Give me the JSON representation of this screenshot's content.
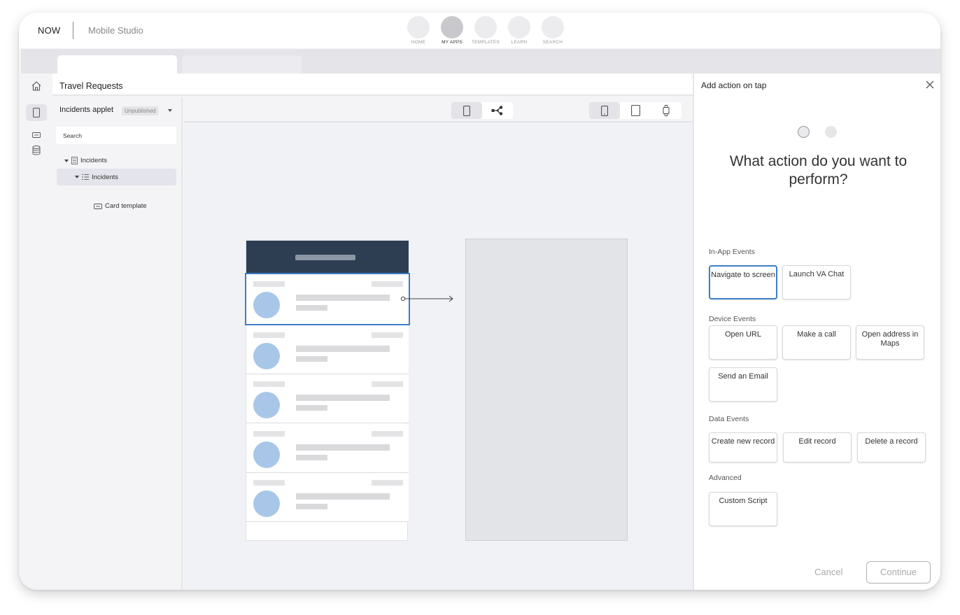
{
  "app": {
    "brand": "NOW",
    "product": "Mobile Studio"
  },
  "nav": [
    {
      "label": "HOME",
      "active": false
    },
    {
      "label": "MY APPS",
      "active": true
    },
    {
      "label": "TEMPLATES",
      "active": false
    },
    {
      "label": "LEARN",
      "active": false
    },
    {
      "label": "SEARCH",
      "active": false
    }
  ],
  "header": {
    "title": "Travel Requests"
  },
  "tree": {
    "applet_name": "Incidents applet",
    "status_badge": "Unpublished",
    "search_placeholder": "Search",
    "nodes": [
      {
        "label": "Incidents",
        "icon": "document-icon"
      },
      {
        "label": "Incidents",
        "icon": "list-icon"
      },
      {
        "label": "Card template",
        "icon": "card-icon"
      }
    ]
  },
  "panel": {
    "title": "Add action on tap",
    "question": "What action do you want to perform?",
    "step": 1,
    "steps_total": 2,
    "sections": {
      "in_app": "In-App Events",
      "device": "Device Events",
      "data": "Data Events",
      "advanced": "Advanced"
    },
    "actions": {
      "navigate": "Navigate to screen",
      "launch_va": "Launch VA Chat",
      "open_url": "Open URL",
      "make_call": "Make a call",
      "open_maps": "Open address in Maps",
      "send_email": "Send an Email",
      "create_record": "Create new record",
      "edit_record": "Edit record",
      "delete_record": "Delete a record",
      "custom_script": "Custom Script"
    },
    "selected_action": "Navigate to screen",
    "cancel_label": "Cancel",
    "continue_label": "Continue"
  },
  "colors": {
    "accent": "#3d7fc6",
    "phone_header": "#2d3e52",
    "avatar": "#a8c7e8"
  }
}
